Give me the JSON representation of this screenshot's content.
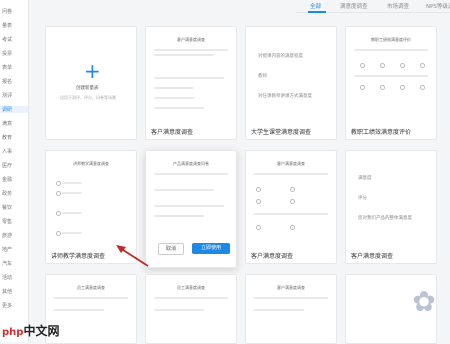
{
  "sidebar": {
    "items": [
      {
        "label": "问卷"
      },
      {
        "label": "量表"
      },
      {
        "label": "考试"
      },
      {
        "label": "投票"
      },
      {
        "label": "表单"
      },
      {
        "label": "报名"
      },
      {
        "label": "测评"
      },
      {
        "label": "调研"
      },
      {
        "label": "满意"
      },
      {
        "label": "教育"
      },
      {
        "label": "人事"
      },
      {
        "label": "医疗"
      },
      {
        "label": "金融"
      },
      {
        "label": "政务"
      },
      {
        "label": "餐饮"
      },
      {
        "label": "零售"
      },
      {
        "label": "旅游"
      },
      {
        "label": "地产"
      },
      {
        "label": "汽车"
      },
      {
        "label": "活动"
      },
      {
        "label": "其他"
      },
      {
        "label": "更多"
      }
    ]
  },
  "tabs": [
    {
      "label": "全部"
    },
    {
      "label": "满意度调查"
    },
    {
      "label": "市场调查"
    },
    {
      "label": "NPS等级调查"
    }
  ],
  "create_card": {
    "title": "创建新量表",
    "subtitle": "适用于测评、评分、问卷等场景"
  },
  "cards": [
    {
      "title": "客户满意度调查",
      "preview_title": "客户满意度调查"
    },
    {
      "title": "大学生课堂满意度调查",
      "preview_lines": [
        "对授课内容的满意程度",
        "教师",
        "对任课教师讲课方式满意度"
      ]
    },
    {
      "title": "教职工绩效满意度评价",
      "preview_title": "教职工绩效满意度评价"
    },
    {
      "title": "讲师教学满意度调查",
      "preview_title": "讲师教学满意度调查"
    },
    {
      "title": "",
      "preview_title": "产品满意度调查问卷",
      "cancel_label": "取消",
      "use_label": "立即使用"
    },
    {
      "title": "客户满意度调查",
      "preview_title": "客户满意度调查"
    },
    {
      "title": "客户满意度调查",
      "preview_lines": [
        "满意度",
        "评分",
        "您对我们产品的整体满意度"
      ]
    },
    {
      "title": "",
      "preview_title": "员工满意度调查"
    },
    {
      "title": "",
      "preview_title": "员工满意度调查"
    },
    {
      "title": "",
      "preview_title": "客户满意度调查"
    }
  ],
  "logo": {
    "prefix": "php",
    "text": "中文网"
  },
  "colors": {
    "accent": "#1e88e5",
    "arrow": "#c62828"
  }
}
